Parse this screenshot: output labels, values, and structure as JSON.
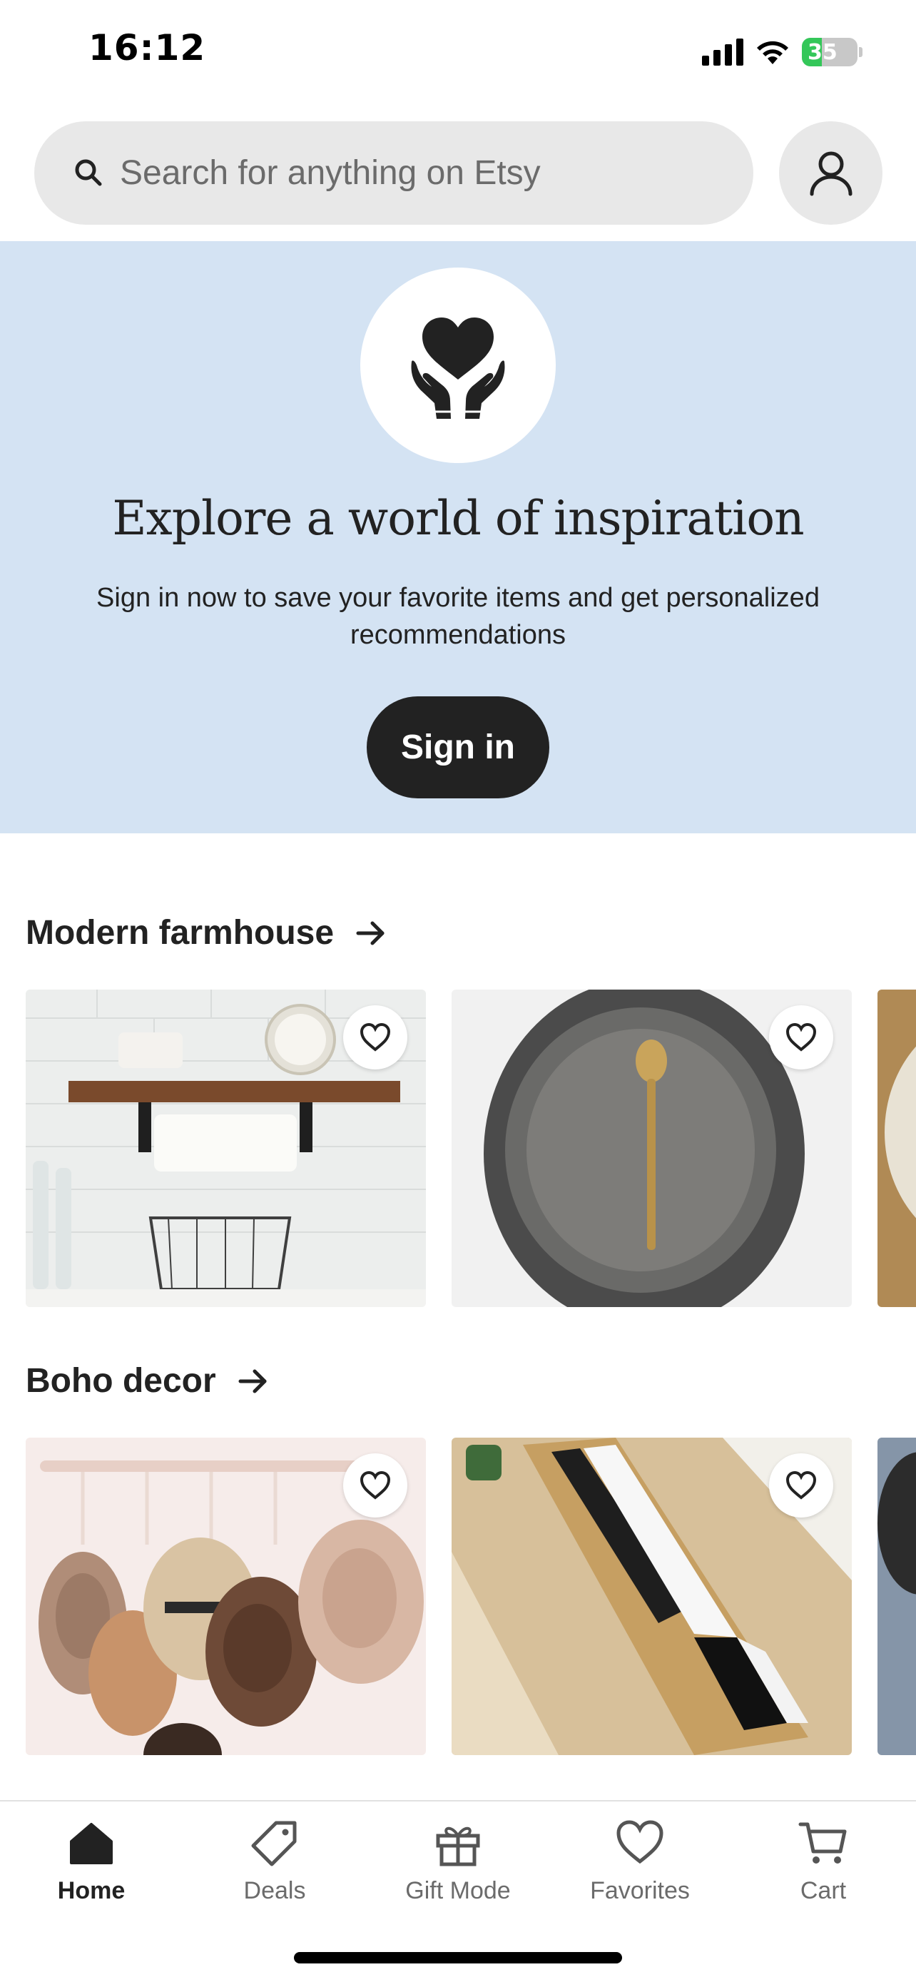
{
  "status_bar": {
    "time": "16:12",
    "battery_level": "35",
    "icons": [
      "cellular-signal-icon",
      "wifi-icon",
      "battery-charging-icon"
    ]
  },
  "search": {
    "placeholder": "Search for anything on Etsy",
    "icon": "search-icon"
  },
  "account": {
    "icon": "user-icon"
  },
  "hero": {
    "emblem_icon": "heart-hands-icon",
    "title": "Explore a world of inspiration",
    "subtitle": "Sign in now to save your favorite items and get personalized recommendations",
    "button_label": "Sign in",
    "background_color": "#d4e3f3"
  },
  "sections": [
    {
      "title": "Modern farmhouse",
      "items": [
        {
          "image": "kitchen shelf with paper towel holder",
          "favorite_icon": "heart-outline-icon"
        },
        {
          "image": "grey oval platter with brass spoon",
          "favorite_icon": "heart-outline-icon"
        },
        {
          "image": "ceramic plate (partially visible)"
        }
      ]
    },
    {
      "title": "Boho decor",
      "items": [
        {
          "image": "hats hanging on wall rack",
          "favorite_icon": "heart-outline-icon"
        },
        {
          "image": "woven rope bench",
          "favorite_icon": "heart-outline-icon"
        },
        {
          "image": "decor item (partially visible)"
        }
      ]
    }
  ],
  "bottom_nav": {
    "active": "Home",
    "items": [
      {
        "label": "Home",
        "icon": "home-icon"
      },
      {
        "label": "Deals",
        "icon": "tag-icon"
      },
      {
        "label": "Gift Mode",
        "icon": "gift-icon"
      },
      {
        "label": "Favorites",
        "icon": "heart-icon"
      },
      {
        "label": "Cart",
        "icon": "cart-icon"
      }
    ]
  },
  "colors": {
    "accent_dark": "#222222",
    "hero_bg": "#d4e3f3",
    "search_bg": "#e8e8e8",
    "battery_green": "#34c759"
  }
}
